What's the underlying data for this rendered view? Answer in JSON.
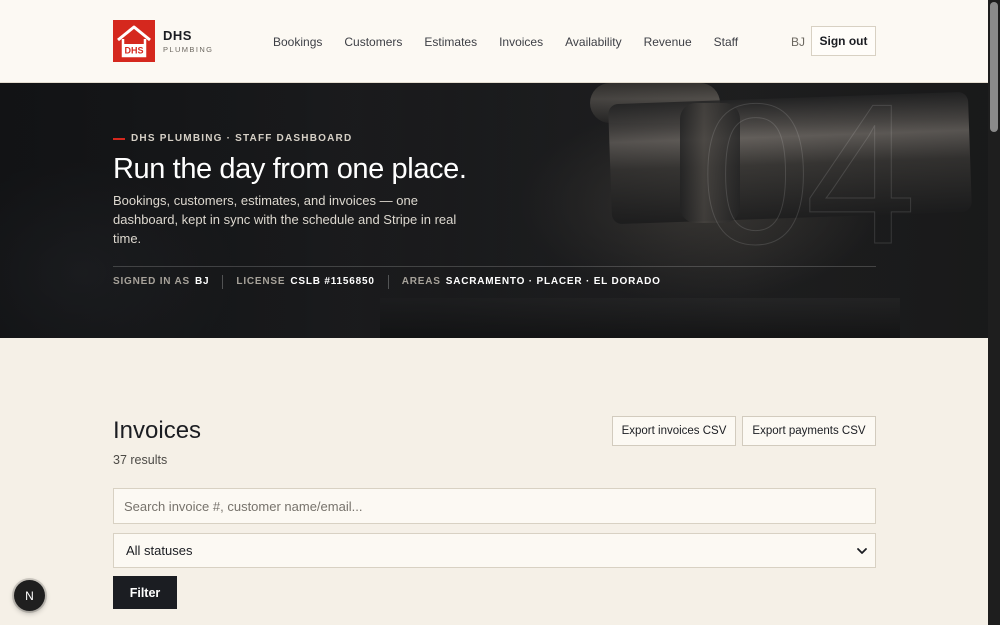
{
  "brand": {
    "name": "DHS",
    "sub": "PLUMBING",
    "logo_text": "DHS",
    "accent_color": "#d5281e"
  },
  "nav": {
    "items": [
      "Bookings",
      "Customers",
      "Estimates",
      "Invoices",
      "Availability",
      "Revenue",
      "Staff"
    ],
    "user_initials": "BJ",
    "sign_out_label": "Sign out"
  },
  "hero": {
    "eyebrow": "DHS PLUMBING · STAFF DASHBOARD",
    "title": "Run the day from one place.",
    "description": "Bookings, customers, estimates, and invoices — one dashboard, kept in sync with the schedule and Stripe in real time.",
    "decorative_number": "04",
    "meta": [
      {
        "label": "SIGNED IN AS",
        "value": "BJ"
      },
      {
        "label": "LICENSE",
        "value": "CSLB #1156850"
      },
      {
        "label": "AREAS",
        "value": "SACRAMENTO · PLACER · EL DORADO"
      }
    ]
  },
  "invoices": {
    "title": "Invoices",
    "count_text": "37 results",
    "export_invoices_label": "Export invoices CSV",
    "export_payments_label": "Export payments CSV",
    "search_placeholder": "Search invoice #, customer name/email...",
    "search_value": "",
    "status_selected": "All statuses",
    "filter_label": "Filter"
  },
  "dev_badge": {
    "label": "N"
  }
}
